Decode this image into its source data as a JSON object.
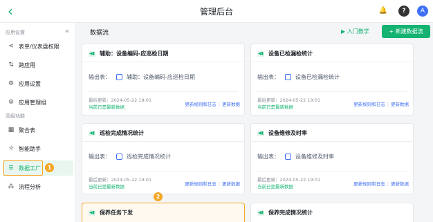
{
  "header": {
    "title": "管理后台",
    "back_icon": "‹",
    "avatar_letter": "A"
  },
  "sidebar": {
    "section_app": "应用设置",
    "section_advanced": "高级功能",
    "collapse_icon": "«",
    "app_items": [
      {
        "label": "表单/仪表盘权限",
        "icon": "share-icon"
      },
      {
        "label": "跨应用",
        "icon": "cross-app-icon"
      },
      {
        "label": "应用设置",
        "icon": "gear-icon"
      },
      {
        "label": "应用管理组",
        "icon": "gear-group-icon"
      }
    ],
    "advanced_items": [
      {
        "label": "聚合表",
        "icon": "table-icon"
      },
      {
        "label": "智能助手",
        "icon": "bulb-icon"
      },
      {
        "label": "数据工厂",
        "icon": "database-icon",
        "active": true
      },
      {
        "label": "流程分析",
        "icon": "flow-icon"
      }
    ]
  },
  "annotations": {
    "badge_1": "1",
    "badge_2": "2"
  },
  "main": {
    "title": "数据流",
    "tutorial_label": "入门教学",
    "new_button_label": "+ 新建数据流",
    "output_label": "输出表：",
    "update_prefix": "最后更新：",
    "status_latest": "当前已是最新数据",
    "action_rules": "更新规则和日志",
    "action_update": "更新数据",
    "cards": [
      {
        "name": "辅助：设备编码-应巡检日期",
        "output": "辅助：设备编码-应巡检日期",
        "updated": "2024-05-22 19:01"
      },
      {
        "name": "设备已检漏检统计",
        "output": "设备已检漏检统计",
        "updated": "2024-05-22 19:01"
      },
      {
        "name": "巡检完成情况统计",
        "output": "巡检完成情况统计",
        "updated": "2024-05-22 19:01"
      },
      {
        "name": "设备维修及时率",
        "output": "设备维修及时率",
        "updated": "2024-05-22 19:01"
      },
      {
        "name": "保养任务下发",
        "highlight": true
      },
      {
        "name": "保养完成情况统计"
      }
    ]
  },
  "colors": {
    "accent": "#15b371",
    "link": "#3f6ff5",
    "highlight": "#f5a623"
  }
}
